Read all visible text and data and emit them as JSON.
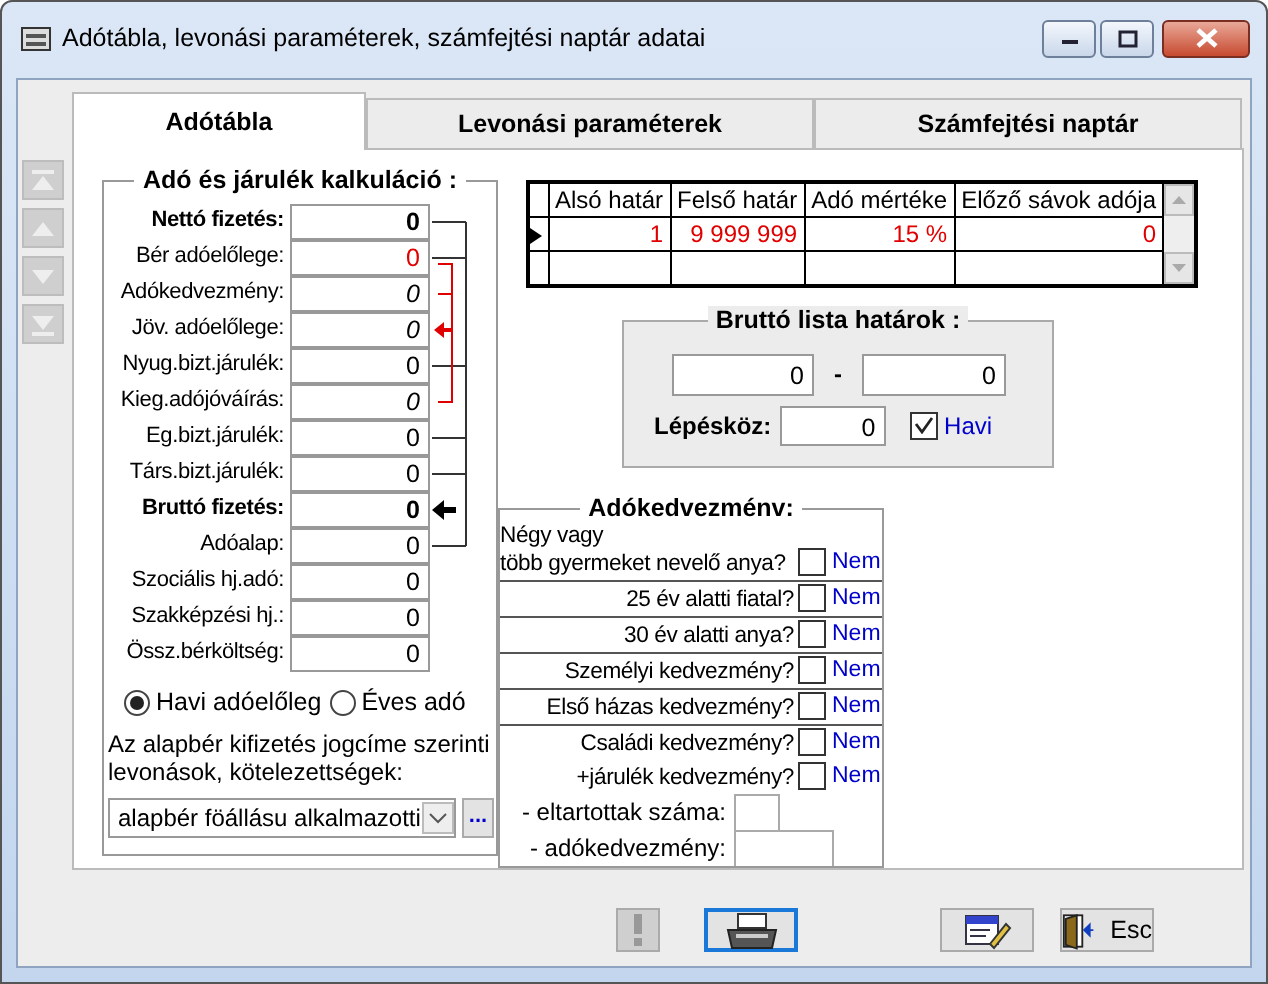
{
  "window": {
    "title": "Adótábla, levonási paraméterek, számfejtési naptár adatai"
  },
  "tabs": [
    {
      "label": "Adótábla",
      "selected": true
    },
    {
      "label": "Levonási paraméterek",
      "selected": false
    },
    {
      "label": "Számfejtési naptár",
      "selected": false
    }
  ],
  "record_nav": [
    {
      "kind": "first"
    },
    {
      "kind": "prev"
    },
    {
      "kind": "next"
    },
    {
      "kind": "last"
    }
  ],
  "calculation": {
    "title": "Adó és járulék kalkuláció :",
    "rows": [
      {
        "label": "Nettó fizetés:",
        "value": "0",
        "kind": "total"
      },
      {
        "label": "Bér adóelőlege:",
        "value": "0",
        "kind": "alert"
      },
      {
        "label": "Adókedvezmény:",
        "value": "0",
        "kind": "derived"
      },
      {
        "label": "Jöv. adóelőlege:",
        "value": "0",
        "kind": "derived"
      },
      {
        "label": "Nyug.bizt.járulék:",
        "value": "0",
        "kind": "plain"
      },
      {
        "label": "Kieg.adójóváírás:",
        "value": "0",
        "kind": "derived"
      },
      {
        "label": "Eg.bizt.járulék:",
        "value": "0",
        "kind": "plain"
      },
      {
        "label": "Társ.bizt.járulék:",
        "value": "0",
        "kind": "plain"
      },
      {
        "label": "Bruttó fizetés:",
        "value": "0",
        "kind": "total"
      },
      {
        "label": "Adóalap:",
        "value": "0",
        "kind": "plain"
      },
      {
        "label": "Szociális hj.adó:",
        "value": "0",
        "kind": "plain"
      },
      {
        "label": "Szakképzési hj.:",
        "value": "0",
        "kind": "plain"
      },
      {
        "label": "Össz.bérköltség:",
        "value": "0",
        "kind": "plain"
      }
    ],
    "period": [
      {
        "label": "Havi adóelőleg",
        "selected": true
      },
      {
        "label": "Éves adó",
        "selected": false
      }
    ],
    "deductions_label": "Az alapbér kifizetés jogcíme szerinti levonások, kötelezettségek:",
    "deductions_value": "alapbér föállásu alkalmazotti",
    "more_button": "..."
  },
  "tax_table": {
    "columns": [
      "Alsó határ",
      "Felső határ",
      "Adó mértéke",
      "Előző sávok adója"
    ],
    "rows": [
      {
        "cells": [
          "1",
          "9 999 999",
          "15 %",
          "0"
        ],
        "current": true
      }
    ]
  },
  "gross_list": {
    "title": "Bruttó lista határok :",
    "from": "0",
    "separator": "-",
    "to": "0",
    "step_label": "Lépésköz:",
    "step": "0",
    "monthly": {
      "label": "Havi",
      "checked": true
    }
  },
  "allowances": {
    "title": "Adókedvezménv:",
    "sections": [
      [
        {
          "label": "Négy vagy\ntöbb gyermeket nevelő anya?",
          "checked": false,
          "answer": "Nem"
        }
      ],
      [
        {
          "label": "25 év alatti fiatal?",
          "checked": false,
          "answer": "Nem"
        }
      ],
      [
        {
          "label": "30 év alatti anya?",
          "checked": false,
          "answer": "Nem"
        }
      ],
      [
        {
          "label": "Személyi kedvezmény?",
          "checked": false,
          "answer": "Nem"
        }
      ],
      [
        {
          "label": "Első házas kedvezmény?",
          "checked": false,
          "answer": "Nem"
        }
      ],
      [
        {
          "label": "Családi kedvezmény?",
          "checked": false,
          "answer": "Nem"
        },
        {
          "label": "+járulék kedvezmény?",
          "checked": false,
          "answer": "Nem"
        }
      ]
    ],
    "sub_fields": [
      {
        "label": "- eltartottak száma:"
      },
      {
        "label": "- adókedvezmény:"
      }
    ]
  },
  "buttons": [
    {
      "kind": "alert",
      "disabled": true,
      "focused": false
    },
    {
      "kind": "print",
      "disabled": false,
      "focused": true
    },
    {
      "kind": "edit",
      "disabled": false,
      "focused": false
    },
    {
      "kind": "exit",
      "label": "Esc",
      "disabled": false,
      "focused": false
    }
  ]
}
